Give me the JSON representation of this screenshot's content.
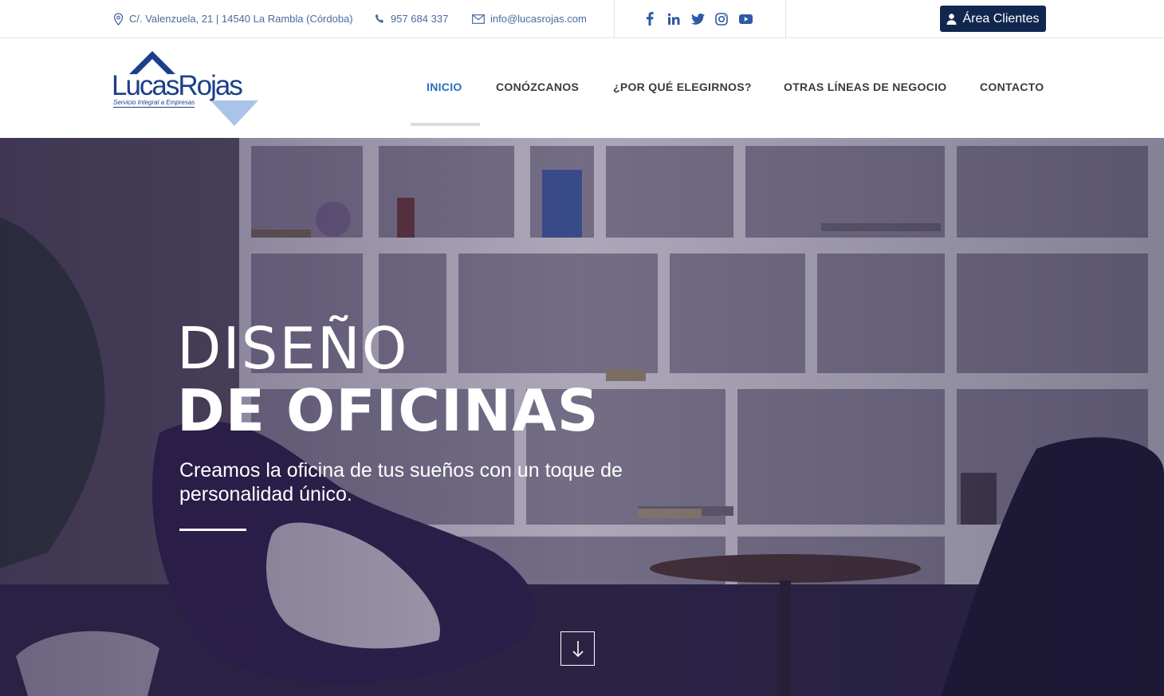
{
  "topbar": {
    "address": "C/. Valenzuela, 21 | 14540 La Rambla (Córdoba)",
    "phone": "957 684 337",
    "email": "info@lucasrojas.com",
    "social_icons": [
      "facebook-icon",
      "linkedin-icon",
      "twitter-icon",
      "instagram-icon",
      "youtube-icon"
    ],
    "area_button": "Área Clientes"
  },
  "logo": {
    "name": "LucasRojas",
    "tagline": "Servicio Integral a Empresas"
  },
  "nav": {
    "items": [
      {
        "label": "INICIO",
        "active": true
      },
      {
        "label": "CONÓZCANOS",
        "active": false
      },
      {
        "label": "¿POR QUÉ ELEGIRNOS?",
        "active": false
      },
      {
        "label": "OTRAS LÍNEAS DE NEGOCIO",
        "active": false
      },
      {
        "label": "CONTACTO",
        "active": false
      }
    ]
  },
  "hero": {
    "title_line1": "DISEÑO",
    "title_line2": "DE OFICINAS",
    "subtitle": "Creamos la oficina de tus sueños con un toque de personalidad único."
  },
  "colors": {
    "brand_blue": "#1c3f8a",
    "button_navy": "#12274f",
    "nav_active": "#2b6cc0",
    "topbar_text": "#4a6aa0"
  }
}
